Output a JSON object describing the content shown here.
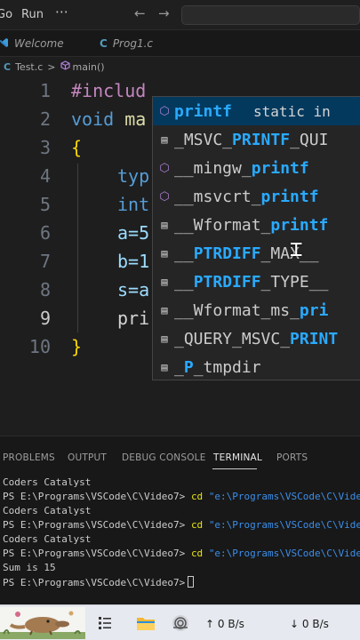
{
  "menubar": {
    "items": [
      "Go",
      "Run"
    ],
    "more_label": "⋯",
    "back_arrow": "←",
    "forward_arrow": "→"
  },
  "tabs": [
    {
      "icon": "vscode-icon",
      "label": "Welcome"
    },
    {
      "icon": "c-file-icon",
      "icon_text": "C",
      "label": "Prog1.c"
    }
  ],
  "breadcrumb": {
    "file_icon": "C",
    "file": "Test.c",
    "separator": ">",
    "symbol": "main()"
  },
  "editor": {
    "line_numbers": [
      "1",
      "2",
      "3",
      "4",
      "5",
      "6",
      "7",
      "8",
      "9",
      "10"
    ],
    "active_line": "9",
    "lines": {
      "l1_directive": "#includ",
      "l2_type": "void",
      "l2_fn": "ma",
      "l3_brace": "{",
      "l4_text": "typ",
      "l5_text": "int",
      "l6_text": "a=5",
      "l7_text": "b=1",
      "l8_text": "s=a",
      "l9_text": "pri",
      "l10_brace": "}"
    }
  },
  "suggest": {
    "selected_detail": "static in",
    "items": [
      {
        "icon": "method-icon",
        "pre": "",
        "match": "printf",
        "post": ""
      },
      {
        "icon": "constant-icon",
        "pre": "_MSVC_",
        "match": "PRINTF",
        "post": "_QUI"
      },
      {
        "icon": "method-icon",
        "pre": "__mingw_",
        "match": "printf",
        "post": ""
      },
      {
        "icon": "method-icon",
        "pre": "__msvcrt_",
        "match": "printf",
        "post": ""
      },
      {
        "icon": "constant-icon",
        "pre": "__Wformat_",
        "match": "printf",
        "post": ""
      },
      {
        "icon": "constant-icon",
        "pre": "__",
        "match": "PTRDIFF",
        "post": "_MAX__"
      },
      {
        "icon": "constant-icon",
        "pre": "__",
        "match": "PTRDIFF",
        "post": "_TYPE__"
      },
      {
        "icon": "constant-icon",
        "pre": "__Wformat_ms_",
        "match": "pri",
        "post": ""
      },
      {
        "icon": "constant-icon",
        "pre": "_QUERY_MSVC_",
        "match": "PRINT",
        "post": ""
      },
      {
        "icon": "constant-icon",
        "pre": "_",
        "match": "P",
        "post": "_tmpdir"
      }
    ]
  },
  "panel": {
    "tabs": [
      "PROBLEMS",
      "OUTPUT",
      "DEBUG CONSOLE",
      "TERMINAL",
      "PORTS"
    ],
    "active_tab": "TERMINAL",
    "terminal": {
      "prompt": "PS E:\\Programs\\VSCode\\C\\Video7>",
      "cd_cmd": "cd",
      "cd_arg": "\"e:\\Programs\\VSCode\\C\\Vide",
      "output_name": "Coders Catalyst",
      "output_sum": "Sum is 15"
    }
  },
  "taskbar": {
    "net_up": "0 B/s",
    "net_down": "0 B/s",
    "net_up_arrow": "↑",
    "net_down_arrow": "↓"
  },
  "colors": {
    "editor_bg": "#1e1e1e",
    "keyword": "#569cd6",
    "preprocessor": "#c586c0",
    "match_highlight": "#2aaaff",
    "selection": "#04395e"
  }
}
